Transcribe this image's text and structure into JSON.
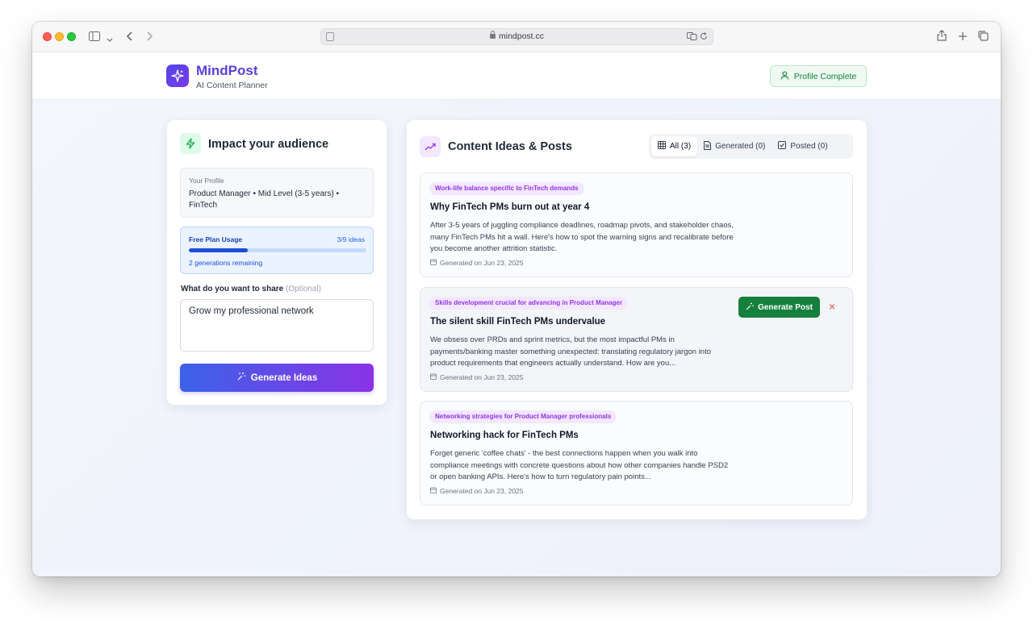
{
  "browser": {
    "url": "mindpost.cc",
    "icons": [
      "sidebar-icon",
      "chevron-down-icon",
      "back-icon",
      "forward-icon",
      "translate-icon",
      "reload-icon",
      "share-icon",
      "new-tab-icon",
      "tabs-overview-icon"
    ]
  },
  "header": {
    "brand": "MindPost",
    "subtitle": "AI Content Planner",
    "profile_status": "Profile Complete"
  },
  "left_panel": {
    "title": "Impact your audience",
    "profile": {
      "label": "Your Profile",
      "details": "Product Manager • Mid Level (3-5 years) • FinTech"
    },
    "usage": {
      "label": "Free Plan Usage",
      "count": "3/9 ideas",
      "fraction": 0.333,
      "remaining": "2 generations remaining"
    },
    "share": {
      "label": "What do you want to share",
      "optional": "(Optional)",
      "value": "Grow my professional network"
    },
    "generate_button": "Generate Ideas"
  },
  "right_panel": {
    "title": "Content Ideas & Posts",
    "tabs": [
      {
        "label": "All (3)",
        "icon": "grid-icon",
        "active": true
      },
      {
        "label": "Generated (0)",
        "icon": "document-icon",
        "active": false
      },
      {
        "label": "Posted (0)",
        "icon": "checkbox-icon",
        "active": false
      }
    ],
    "ideas": [
      {
        "tag": "Work-life balance specific to FinTech demands",
        "title": "Why FinTech PMs burn out at year 4",
        "body": "After 3-5 years of juggling compliance deadlines, roadmap pivots, and stakeholder chaos, many FinTech PMs hit a wall. Here's how to spot the warning signs and recalibrate before you become another attrition statistic.",
        "date": "Generated on Jun 23, 2025"
      },
      {
        "tag": "Skills development crucial for advancing in Product Manager",
        "title": "The silent skill FinTech PMs undervalue",
        "body": "We obsess over PRDs and sprint metrics, but the most impactful PMs in payments/banking master something unexpected: translating regulatory jargon into product requirements that engineers actually understand. How are you...",
        "date": "Generated on Jun 23, 2025",
        "action": "Generate Post",
        "dismiss": "×"
      },
      {
        "tag": "Networking strategies for Product Manager professionals",
        "title": "Networking hack for FinTech PMs",
        "body": "Forget generic 'coffee chats' - the best connections happen when you walk into compliance meetings with concrete questions about how other companies handle PSD2 or open banking APIs. Here's how to turn regulatory pain points...",
        "date": "Generated on Jun 23, 2025"
      }
    ]
  },
  "colors": {
    "brand": "#5b3fd6",
    "success": "#15803d",
    "tag_text": "#9333ea",
    "tag_bg": "#f3e8ff",
    "usage_blue": "#1d4ed8"
  }
}
